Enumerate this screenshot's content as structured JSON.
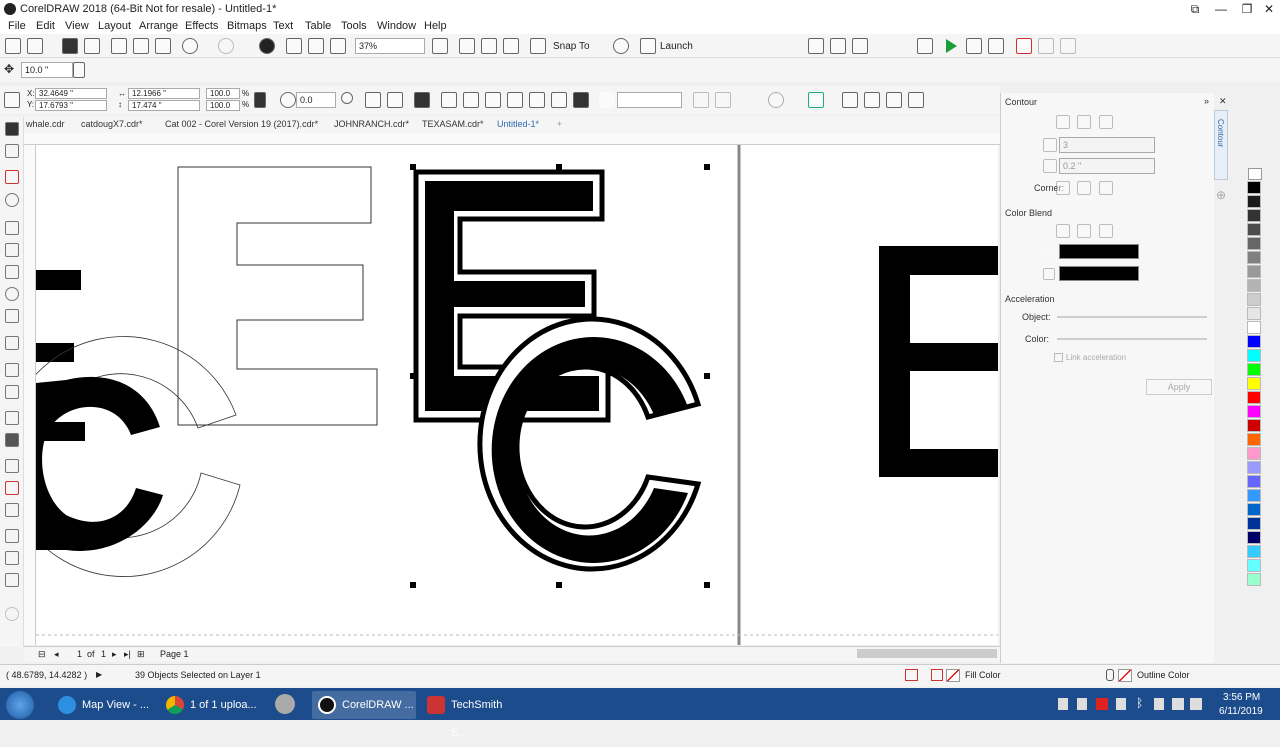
{
  "window": {
    "title": "CorelDRAW 2018 (64-Bit Not for resale) - Untitled-1*"
  },
  "menu": [
    "File",
    "Edit",
    "View",
    "Layout",
    "Arrange",
    "Effects",
    "Bitmaps",
    "Text",
    "Table",
    "Tools",
    "Window",
    "Help"
  ],
  "toolbar": {
    "zoom": "37%",
    "snap_to": "Snap To",
    "launch": "Launch"
  },
  "propbar": {
    "nudge": "10.0 \"",
    "x": "32.4649 \"",
    "y": "17.6793 \"",
    "width": "12.1966 \"",
    "height": "17.474 \"",
    "scale_w": "100.0",
    "scale_h": "100.0",
    "pct": "%",
    "x_label": "X:",
    "y_label": "Y:",
    "rotation": "0.0"
  },
  "tabs": [
    {
      "label": "whale.cdr",
      "active": false
    },
    {
      "label": "catdougX7.cdr*",
      "active": false
    },
    {
      "label": "Cat 002 - Corel Version 19 (2017).cdr*",
      "active": false
    },
    {
      "label": "JOHNRANCH.cdr*",
      "active": false
    },
    {
      "label": "TEXASAM.cdr*",
      "active": false
    },
    {
      "label": "Untitled-1*",
      "active": true
    }
  ],
  "docker": {
    "title": "Contour",
    "side_tab": "Contour",
    "steps": "3",
    "offset": "0.2 \"",
    "corner_label": "Corner:",
    "color_blend_label": "Color Blend",
    "acceleration_label": "Acceleration",
    "object_label": "Object:",
    "color_label": "Color:",
    "link_label": "Link acceleration",
    "apply": "Apply",
    "outline_color": "#000000",
    "fill_color": "#000000"
  },
  "page_nav": {
    "current": "1",
    "of": "of",
    "total": "1",
    "page_tab": "Page 1"
  },
  "status": {
    "coords": "( 48.6789, 14.4282 )",
    "selection": "39 Objects Selected on Layer 1",
    "fill_label": "Fill Color",
    "outline_label": "Outline Color"
  },
  "taskbar": {
    "items": [
      "Map View - ...",
      "1 of 1 uploa...",
      "CorelDRAW ...",
      "TechSmith S..."
    ],
    "time": "3:56 PM",
    "date": "6/11/2019"
  },
  "palette": [
    "#000000",
    "#1a1a1a",
    "#333333",
    "#4d4d4d",
    "#666666",
    "#808080",
    "#999999",
    "#b3b3b3",
    "#cccccc",
    "#e6e6e6",
    "#ffffff",
    "#0000ff",
    "#00ffff",
    "#00ff00",
    "#ffff00",
    "#ff0000",
    "#ff00ff",
    "#cc0000",
    "#ff6600",
    "#ff99cc",
    "#9999ff",
    "#6666ff",
    "#3399ff",
    "#0066cc",
    "#003399",
    "#000066",
    "#33ccff",
    "#66ffff",
    "#99ffcc"
  ]
}
